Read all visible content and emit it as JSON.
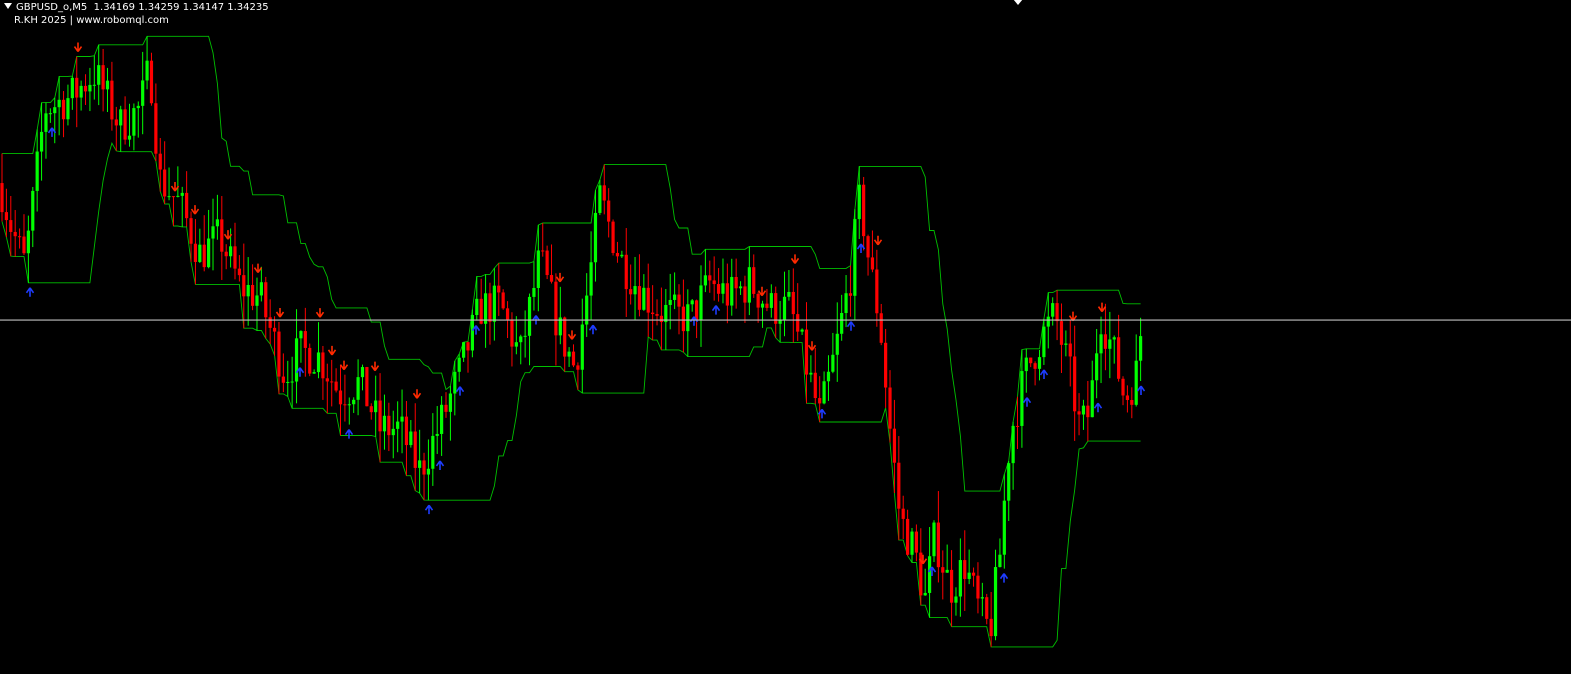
{
  "header": {
    "symbol": "GBPUSD_o,M5",
    "ohlc": "1.34169 1.34259 1.34147 1.34235",
    "credit": "R.KH 2025 | www.robomql.com"
  },
  "colors": {
    "background": "#000000",
    "bull": "#00ff00",
    "bear": "#ff0000",
    "band": "#00c000",
    "buy_arrow": "#1e3cff",
    "sell_arrow": "#ff2a00",
    "price_line": "#c0c0c0"
  },
  "chart_data": {
    "type": "candlestick",
    "symbol": "GBPUSD_o",
    "timeframe": "M5",
    "last_close": 1.34235,
    "path": [
      [
        0,
        1.3439
      ],
      [
        12,
        1.3426
      ],
      [
        25,
        1.3416
      ],
      [
        45,
        1.346
      ],
      [
        70,
        1.3463
      ],
      [
        95,
        1.347
      ],
      [
        120,
        1.3455
      ],
      [
        140,
        1.346
      ],
      [
        150,
        1.3472
      ],
      [
        160,
        1.344
      ],
      [
        180,
        1.3433
      ],
      [
        200,
        1.3419
      ],
      [
        220,
        1.3424
      ],
      [
        240,
        1.341
      ],
      [
        260,
        1.3407
      ],
      [
        285,
        1.3385
      ],
      [
        300,
        1.3392
      ],
      [
        320,
        1.339
      ],
      [
        340,
        1.338
      ],
      [
        360,
        1.3383
      ],
      [
        380,
        1.337
      ],
      [
        400,
        1.337
      ],
      [
        420,
        1.3358
      ],
      [
        440,
        1.3371
      ],
      [
        460,
        1.3386
      ],
      [
        480,
        1.3404
      ],
      [
        500,
        1.3405
      ],
      [
        520,
        1.339
      ],
      [
        540,
        1.3418
      ],
      [
        560,
        1.3397
      ],
      [
        575,
        1.3387
      ],
      [
        590,
        1.3413
      ],
      [
        600,
        1.3435
      ],
      [
        620,
        1.3418
      ],
      [
        640,
        1.3409
      ],
      [
        660,
        1.3403
      ],
      [
        690,
        1.3401
      ],
      [
        710,
        1.3411
      ],
      [
        730,
        1.3407
      ],
      [
        750,
        1.3411
      ],
      [
        770,
        1.3404
      ],
      [
        790,
        1.3404
      ],
      [
        810,
        1.3384
      ],
      [
        820,
        1.3373
      ],
      [
        835,
        1.3391
      ],
      [
        850,
        1.3412
      ],
      [
        860,
        1.3435
      ],
      [
        870,
        1.3415
      ],
      [
        880,
        1.34
      ],
      [
        890,
        1.337
      ],
      [
        900,
        1.3345
      ],
      [
        915,
        1.3335
      ],
      [
        925,
        1.3322
      ],
      [
        935,
        1.334
      ],
      [
        950,
        1.3325
      ],
      [
        965,
        1.3332
      ],
      [
        980,
        1.3318
      ],
      [
        990,
        1.3313
      ],
      [
        1000,
        1.3335
      ],
      [
        1010,
        1.3368
      ],
      [
        1025,
        1.3385
      ],
      [
        1040,
        1.3395
      ],
      [
        1055,
        1.3402
      ],
      [
        1070,
        1.3385
      ],
      [
        1080,
        1.337
      ],
      [
        1090,
        1.3375
      ],
      [
        1100,
        1.3403
      ],
      [
        1115,
        1.339
      ],
      [
        1125,
        1.3378
      ],
      [
        1140,
        1.3388
      ],
      [
        1143,
        1.3396
      ]
    ],
    "candles": 260,
    "price_line": 1.34005,
    "ylim": [
      1.3305,
      1.3482
    ],
    "xlim": [
      0,
      1571
    ],
    "buy_signals": [
      30,
      52,
      300,
      349,
      429,
      440,
      460,
      476,
      536,
      593,
      694,
      716,
      822,
      851,
      861,
      932,
      1004,
      1027,
      1044,
      1098,
      1141
    ],
    "sell_signals": [
      78,
      175,
      195,
      228,
      258,
      280,
      320,
      332,
      344,
      375,
      417,
      560,
      572,
      762,
      795,
      812,
      878,
      923,
      1073,
      1102
    ],
    "grid": false,
    "legend": "none"
  }
}
